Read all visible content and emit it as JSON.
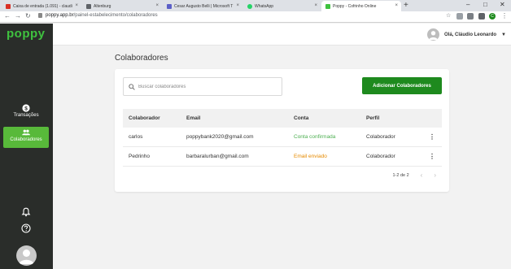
{
  "browser": {
    "tabs": [
      {
        "title": "Caixa de entrada (1.091) - claudi",
        "color": "#d93025",
        "active": false
      },
      {
        "title": "Altenburg",
        "color": "#5f6368",
        "active": false
      },
      {
        "title": "Cesar Augusto Belli | Microsoft T",
        "color": "#5b5fc7",
        "active": false
      },
      {
        "title": "WhatsApp",
        "color": "#25d366",
        "active": false
      },
      {
        "title": "Poppy - Cofrinho Online",
        "color": "#3fc23f",
        "active": true
      }
    ],
    "new_tab": "+",
    "url_host": "poppy.app.br",
    "url_path": "/painel-estabelecimento/colaboradores",
    "profile_initial": "C"
  },
  "sidebar": {
    "logo": "poppy",
    "items": [
      {
        "label": "Transações",
        "icon": "dollar-icon",
        "active": false
      },
      {
        "label": "Colaboradores",
        "icon": "people-icon",
        "active": true
      }
    ]
  },
  "header": {
    "greeting": "Olá, Cláudio Leonardo"
  },
  "main": {
    "title": "Colaboradores",
    "search_placeholder": "Buscar colaboradores",
    "add_button": "Adicionar Colaboradores",
    "columns": [
      "Colaborador",
      "Email",
      "Conta",
      "Perfil"
    ],
    "rows": [
      {
        "name": "carlos",
        "email": "poppybank2020@gmail.com",
        "status": "Conta confirmada",
        "status_color": "#4caf50",
        "profile": "Colaborador"
      },
      {
        "name": "Pedrinho",
        "email": "barbaralurban@gmail.com",
        "status": "Email enviado",
        "status_color": "#e68a00",
        "profile": "Colaborador"
      }
    ],
    "pagination": "1-2 de 2"
  },
  "colors": {
    "brand_green": "#3fc23f",
    "button_green": "#1e8a1e",
    "sidebar_bg": "#2a2d2a",
    "active_nav": "#58b93a"
  }
}
